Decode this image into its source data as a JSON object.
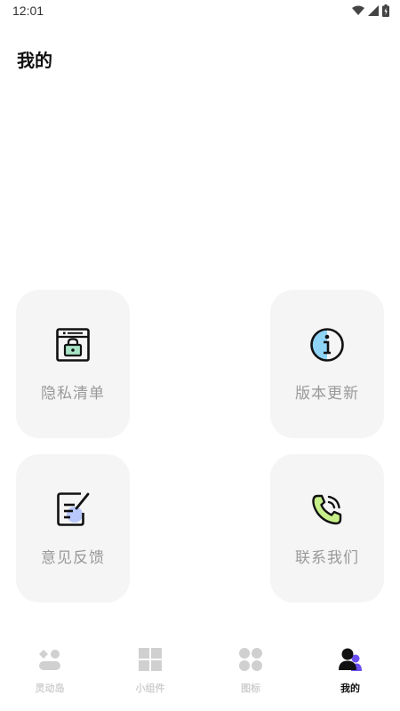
{
  "status_bar": {
    "time": "12:01"
  },
  "header": {
    "title": "我的"
  },
  "cards": {
    "privacy": {
      "label": "隐私清单",
      "icon": "privacy-list-icon"
    },
    "version": {
      "label": "版本更新",
      "icon": "info-icon"
    },
    "feedback": {
      "label": "意见反馈",
      "icon": "feedback-edit-icon"
    },
    "contact": {
      "label": "联系我们",
      "icon": "phone-call-icon"
    }
  },
  "tab_bar": {
    "items": [
      {
        "label": "灵动岛",
        "icon": "island-icon"
      },
      {
        "label": "小组件",
        "icon": "widgets-icon"
      },
      {
        "label": "图标",
        "icon": "icons-grid-icon"
      },
      {
        "label": "我的",
        "icon": "user-icon",
        "active": true
      }
    ]
  },
  "colors": {
    "accent_blue": "#5b9bf0",
    "accent_purple": "#6a4ff5",
    "accent_green": "#c8f08a",
    "card_bg": "#f5f5f5",
    "inactive_tab": "#d0d0d0"
  }
}
